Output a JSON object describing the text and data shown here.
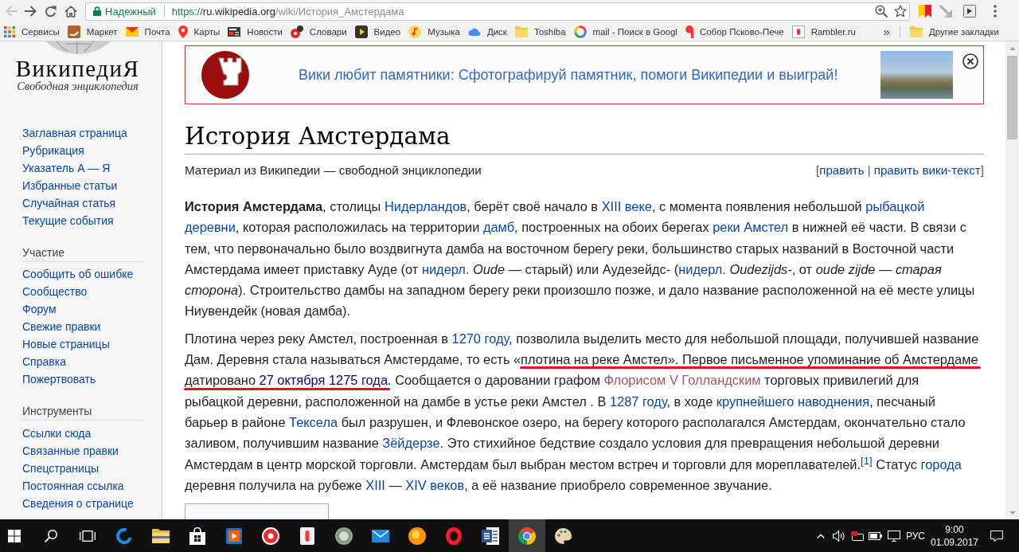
{
  "browser": {
    "back": {
      "disabled": true
    },
    "forward": {
      "disabled": false
    },
    "security": {
      "secure": true,
      "label": "Надежный"
    },
    "url": {
      "scheme": "https://",
      "host": "ru.wikipedia.org",
      "path": "/wiki/История_Амстердама"
    },
    "page_zoomed": true,
    "bookmarked": false
  },
  "bookmarks_bar": {
    "items": [
      {
        "kind": "apps",
        "label": "Сервисы"
      },
      {
        "kind": "site",
        "label": "Маркет"
      },
      {
        "kind": "site",
        "label": "Почта"
      },
      {
        "kind": "site",
        "label": "Карты"
      },
      {
        "kind": "site",
        "label": "Новости"
      },
      {
        "kind": "site",
        "label": "Словари"
      },
      {
        "kind": "site",
        "label": "Видео"
      },
      {
        "kind": "site",
        "label": "Музыка"
      },
      {
        "kind": "site",
        "label": "Диск"
      },
      {
        "kind": "folder",
        "label": "Toshiba"
      },
      {
        "kind": "site",
        "label": "mail - Поиск в Googl"
      },
      {
        "kind": "site",
        "label": "Собор Псково-Пече"
      },
      {
        "kind": "site",
        "label": "Rambler.ru"
      }
    ],
    "overflow": "»",
    "other": {
      "label": "Другие закладки"
    }
  },
  "sidebar": {
    "logo": {
      "wordmark": "ВикипедиЯ",
      "tagline": "Свободная энциклопедия"
    },
    "navigation": [
      "Заглавная страница",
      "Рубрикация",
      "Указатель А — Я",
      "Избранные статьи",
      "Случайная статья",
      "Текущие события"
    ],
    "sections": [
      {
        "heading": "Участие",
        "items": [
          "Сообщить об ошибке",
          "Сообщество",
          "Форум",
          "Свежие правки",
          "Новые страницы",
          "Справка",
          "Пожертвовать"
        ]
      },
      {
        "heading": "Инструменты",
        "items": [
          "Ссылки сюда",
          "Связанные правки",
          "Спецстраницы",
          "Постоянная ссылка",
          "Сведения о странице"
        ]
      }
    ]
  },
  "banner": {
    "text": "Вики любит памятники: Сфотографируй памятник, помоги Википедии и выиграй!"
  },
  "article": {
    "title": "История Амстердама",
    "tagline": "Материал из Википедии — свободной энциклопедии",
    "edit": {
      "open": "[",
      "links": [
        "править",
        "править вики-текст"
      ],
      "separator": "|",
      "close": "]"
    },
    "paragraphs": [
      {
        "runs": [
          {
            "kind": "bold",
            "text": "История Амстердама"
          },
          {
            "kind": "text",
            "text": ", столицы "
          },
          {
            "kind": "link",
            "text": "Нидерландов"
          },
          {
            "kind": "text",
            "text": ", берёт своё начало в "
          },
          {
            "kind": "link",
            "text": "XIII веке"
          },
          {
            "kind": "text",
            "text": ", с момента появления небольшой "
          },
          {
            "kind": "link",
            "text": "рыбацкой "
          },
          {
            "kind": "link",
            "text": "деревни"
          },
          {
            "kind": "text",
            "text": ", которая расположилась на территории "
          },
          {
            "kind": "link",
            "text": "дамб"
          },
          {
            "kind": "text",
            "text": ", построенных на обоих берегах "
          },
          {
            "kind": "link",
            "text": "реки Амстел"
          },
          {
            "kind": "text",
            "text": " в нижней её части. В связи с тем, что первоначально было воздвигнута дамба на восточном берегу реки, большинство старых названий в Восточной части Амстердама имеет приставку Ауде (от "
          },
          {
            "kind": "link",
            "text": "нидерл."
          },
          {
            "kind": "italic",
            "text": " Oude"
          },
          {
            "kind": "text",
            "text": " — старый) или Аудезейдс- ("
          },
          {
            "kind": "link",
            "text": "нидерл."
          },
          {
            "kind": "italic",
            "text": " Oudezijds-"
          },
          {
            "kind": "text",
            "text": ", от "
          },
          {
            "kind": "italic",
            "text": "oude zijde"
          },
          {
            "kind": "text",
            "text": " — "
          },
          {
            "kind": "italic",
            "text": "старая сторона"
          },
          {
            "kind": "text",
            "text": "). Строительство дамбы на западном берегу реки произошло позже, и дало название расположенной на её месте улицы Ниувендейк (новая дамба)."
          }
        ]
      },
      {
        "runs": [
          {
            "kind": "text",
            "text": "Плотина через реку Амстел, построенная в "
          },
          {
            "kind": "link",
            "text": "1270 году"
          },
          {
            "kind": "text",
            "text": ", позволила выделить место для небольшой площади, получившей название Дам. Деревня стала называться Амстердаме, то есть «"
          },
          {
            "kind": "underlined",
            "runs": [
              {
                "kind": "text",
                "text": "плотина на реке Амстел». Первое письменное упоминание об Амстердаме "
              }
            ]
          },
          {
            "kind": "underlined",
            "runs": [
              {
                "kind": "text",
                "text": "датировано "
              },
              {
                "kind": "visited_link",
                "text": "27 октября 1275 года"
              }
            ]
          },
          {
            "kind": "text",
            "text": ". Сообщается о даровании графом "
          },
          {
            "kind": "redlink",
            "text": "Флорисом V Голландским"
          },
          {
            "kind": "text",
            "text": " торговых привилегий для рыбацкой деревни, расположенной на дамбе в устье реки Амстел . В "
          },
          {
            "kind": "link",
            "text": "1287 году"
          },
          {
            "kind": "text",
            "text": ", в ходе "
          },
          {
            "kind": "link",
            "text": "крупнейшего наводнения"
          },
          {
            "kind": "text",
            "text": ", песчаный барьер в районе "
          },
          {
            "kind": "link",
            "text": "Тексела"
          },
          {
            "kind": "text",
            "text": " был разрушен, и Флевонское озеро, на берегу которого располагался Амстердам, окончательно стало заливом, получившим название "
          },
          {
            "kind": "link",
            "text": "Зёйдерзе"
          },
          {
            "kind": "text",
            "text": ". Это стихийное бедствие создало условия для превращения небольшой деревни Амстердам в центр морской торговли. Амстердам был выбран местом встреч и торговли для мореплавателей."
          },
          {
            "kind": "footnote",
            "text": "[1]"
          },
          {
            "kind": "text",
            "text": " Статус "
          },
          {
            "kind": "link",
            "text": "города"
          },
          {
            "kind": "text",
            "text": " деревня получила на рубеже "
          },
          {
            "kind": "link",
            "text": "XIII"
          },
          {
            "kind": "text",
            "text": " — "
          },
          {
            "kind": "link",
            "text": "XIV веков"
          },
          {
            "kind": "text",
            "text": ", а её название приобрело современное звучание."
          }
        ]
      }
    ]
  },
  "taskbar": {
    "apps": [
      {
        "active": false
      },
      {
        "active": false
      },
      {
        "active": false
      },
      {
        "active": false
      },
      {
        "active": false
      },
      {
        "active": false
      },
      {
        "active": false
      },
      {
        "active": false
      },
      {
        "active": false
      },
      {
        "active": false
      },
      {
        "active": false
      },
      {
        "active": true
      },
      {
        "active": false
      }
    ],
    "tray": {
      "language": "РУС",
      "time": "9:00",
      "date": "01.09.2017"
    }
  }
}
